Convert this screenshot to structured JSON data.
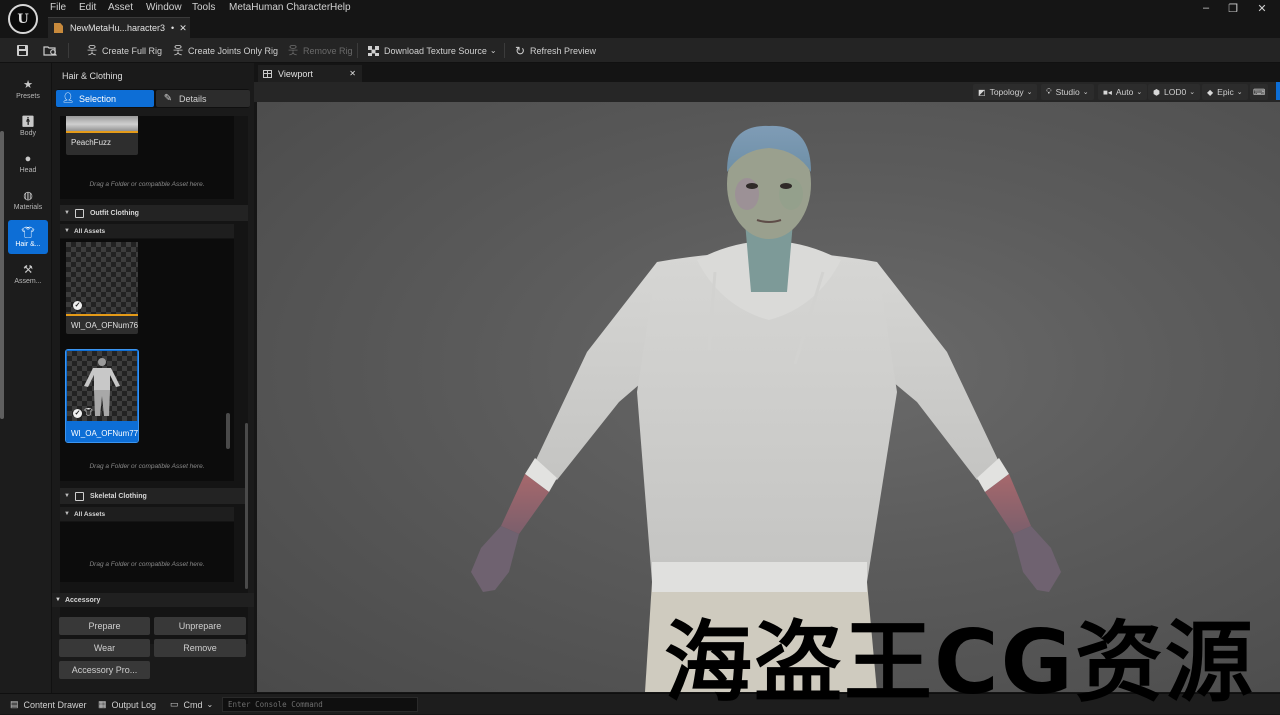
{
  "menu": [
    "File",
    "Edit",
    "Asset",
    "Window",
    "Tools",
    "MetaHuman Character",
    "Help"
  ],
  "document_tab": {
    "title": "NewMetaHu...haracter3",
    "dirty_mark": "•",
    "close": "✕"
  },
  "window_controls": [
    "–",
    "❐",
    "✕"
  ],
  "toolbar": {
    "create_full_rig": "Create Full Rig",
    "create_joints_only_rig": "Create Joints Only Rig",
    "remove_rig": "Remove Rig",
    "download_texture_source": "Download Texture Source",
    "refresh_preview": "Refresh Preview"
  },
  "rail": [
    {
      "label": "Presets",
      "icon": "star-icon"
    },
    {
      "label": "Body",
      "icon": "body-icon"
    },
    {
      "label": "Head",
      "icon": "head-icon"
    },
    {
      "label": "Materials",
      "icon": "materials-icon"
    },
    {
      "label": "Hair &...",
      "icon": "hair-clothing-icon",
      "active": true
    },
    {
      "label": "Assem...",
      "icon": "hammer-icon"
    }
  ],
  "panel": {
    "title": "Hair & Clothing",
    "segments": {
      "selection": "Selection",
      "details": "Details"
    },
    "peachfuzz_label": "PeachFuzz",
    "drag_hint": "Drag a Folder or compatible Asset here.",
    "outfit_section": "Outfit Clothing",
    "all_assets": "All Assets",
    "outfit_items": [
      "WI_OA_OFNum76",
      "WI_OA_OFNum77"
    ],
    "skeletal_section": "Skeletal Clothing",
    "accessory_section": "Accessory",
    "accessory_buttons": {
      "prepare": "Prepare",
      "unprepare": "Unprepare",
      "wear": "Wear",
      "remove": "Remove",
      "properties": "Accessory Pro..."
    }
  },
  "viewport": {
    "tab_label": "Viewport",
    "tab_close": "✕",
    "pills": {
      "topology": "Topology",
      "studio": "Studio",
      "auto": "Auto",
      "lod": "LOD0",
      "quality": "Epic"
    }
  },
  "statusbar": {
    "content_drawer": "Content Drawer",
    "output_log": "Output Log",
    "cmd": "Cmd",
    "console_placeholder": "Enter Console Command"
  },
  "watermark": "海盗王CG资源",
  "colors": {
    "accent": "#0d6ed6",
    "thumb_underline": "#e59b18"
  }
}
